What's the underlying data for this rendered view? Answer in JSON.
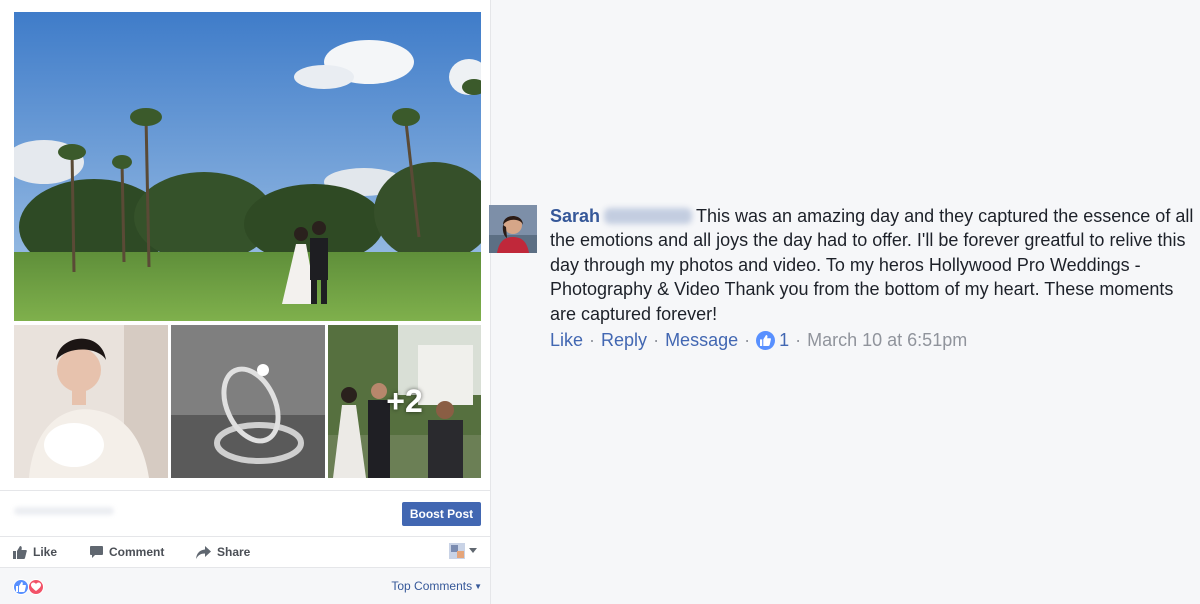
{
  "post": {
    "photos": {
      "main": "wedding-couple-palm-trees",
      "thumbnails": [
        "bride-portrait",
        "wedding-rings",
        "couple-walking-aisle"
      ],
      "more_count": "+2"
    },
    "boost_button": "Boost Post",
    "actions": {
      "like": "Like",
      "comment": "Comment",
      "share": "Share"
    },
    "reactions": [
      "like",
      "love"
    ],
    "top_comments": "Top Comments"
  },
  "comment": {
    "author_name": "Sarah",
    "text": "This was an amazing day and they captured the essence of all the emotions and all joys the day had to offer. I'll be forever greatful to relive this day through my photos and video. To my heros Hollywood Pro Weddings - Photography & Video Thank you from the bottom of my heart. These moments are captured forever!",
    "actions": {
      "like": "Like",
      "reply": "Reply",
      "message": "Message"
    },
    "like_count": "1",
    "timestamp": "March 10 at 6:51pm",
    "separator": "·"
  },
  "colors": {
    "link_blue": "#365899",
    "action_blue": "#4267b2",
    "like_blue": "#5890ff",
    "love_red": "#f25268",
    "meta_gray": "#90949c"
  }
}
